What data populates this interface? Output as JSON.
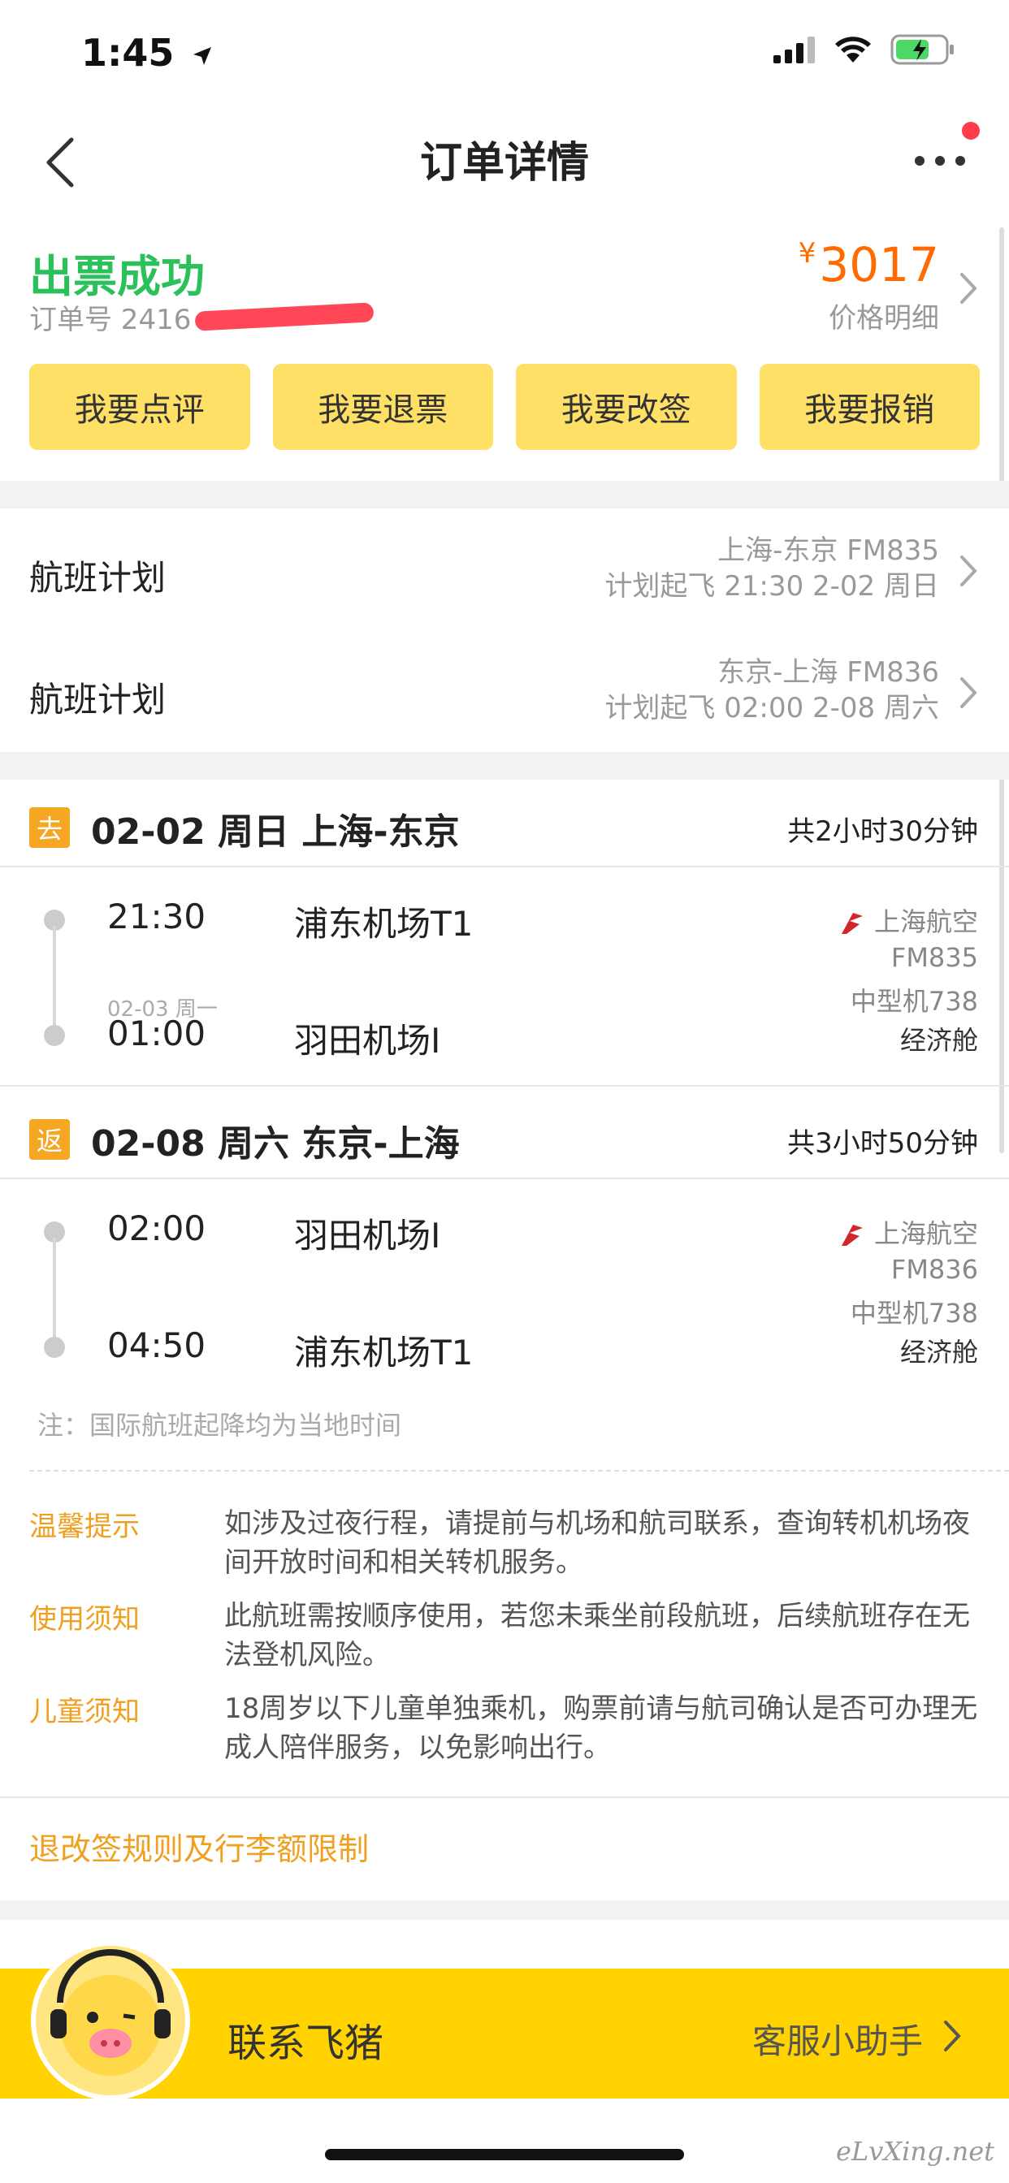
{
  "status_bar": {
    "time": "1:45"
  },
  "nav": {
    "title": "订单详情"
  },
  "order": {
    "status": "出票成功",
    "order_no": "订单号 2416",
    "currency": "¥",
    "price": "3017",
    "price_detail": "价格明细"
  },
  "actions": [
    {
      "label": "我要点评"
    },
    {
      "label": "我要退票"
    },
    {
      "label": "我要改签"
    },
    {
      "label": "我要报销"
    }
  ],
  "plans": [
    {
      "label": "航班计划",
      "line1": "上海-东京 FM835",
      "line2": "计划起飞 21:30 2-02 周日"
    },
    {
      "label": "航班计划",
      "line1": "东京-上海 FM836",
      "line2": "计划起飞 02:00 2-08 周六"
    }
  ],
  "segments": [
    {
      "tag": "去",
      "title": "02-02 周日 上海-东京",
      "duration": "共2小时30分钟",
      "dep_time": "21:30",
      "dep_airport": "浦东机场T1",
      "arr_date": "02-03 周一",
      "arr_time": "01:00",
      "arr_airport": "羽田机场I",
      "airline": "上海航空",
      "flight_no": "FM835",
      "aircraft": "中型机738",
      "cabin": "经济舱"
    },
    {
      "tag": "返",
      "title": "02-08 周六 东京-上海",
      "duration": "共3小时50分钟",
      "dep_time": "02:00",
      "dep_airport": "羽田机场I",
      "arr_time": "04:50",
      "arr_airport": "浦东机场T1",
      "airline": "上海航空",
      "flight_no": "FM836",
      "aircraft": "中型机738",
      "cabin": "经济舱"
    }
  ],
  "note": "注：国际航班起降均为当地时间",
  "tips": [
    {
      "label": "温馨提示",
      "text": "如涉及过夜行程，请提前与机场和航司联系，查询转机机场夜间开放时间和相关转机服务。"
    },
    {
      "label": "使用须知",
      "text": "此航班需按顺序使用，若您未乘坐前段航班，后续航班存在无法登机风险。"
    },
    {
      "label": "儿童须知",
      "text": "18周岁以下儿童单独乘机，购票前请与航司确认是否可办理无成人陪伴服务，以免影响出行。"
    }
  ],
  "rules_link": "退改签规则及行李额限制",
  "banner": {
    "contact": "联系飞猪",
    "helper": "客服小助手"
  },
  "watermark": "eLvXing.net",
  "colors": {
    "success": "#2ac15a",
    "price": "#ff6b00",
    "accent": "#ffd200",
    "button": "#ffe066",
    "tip": "#f0a020"
  }
}
